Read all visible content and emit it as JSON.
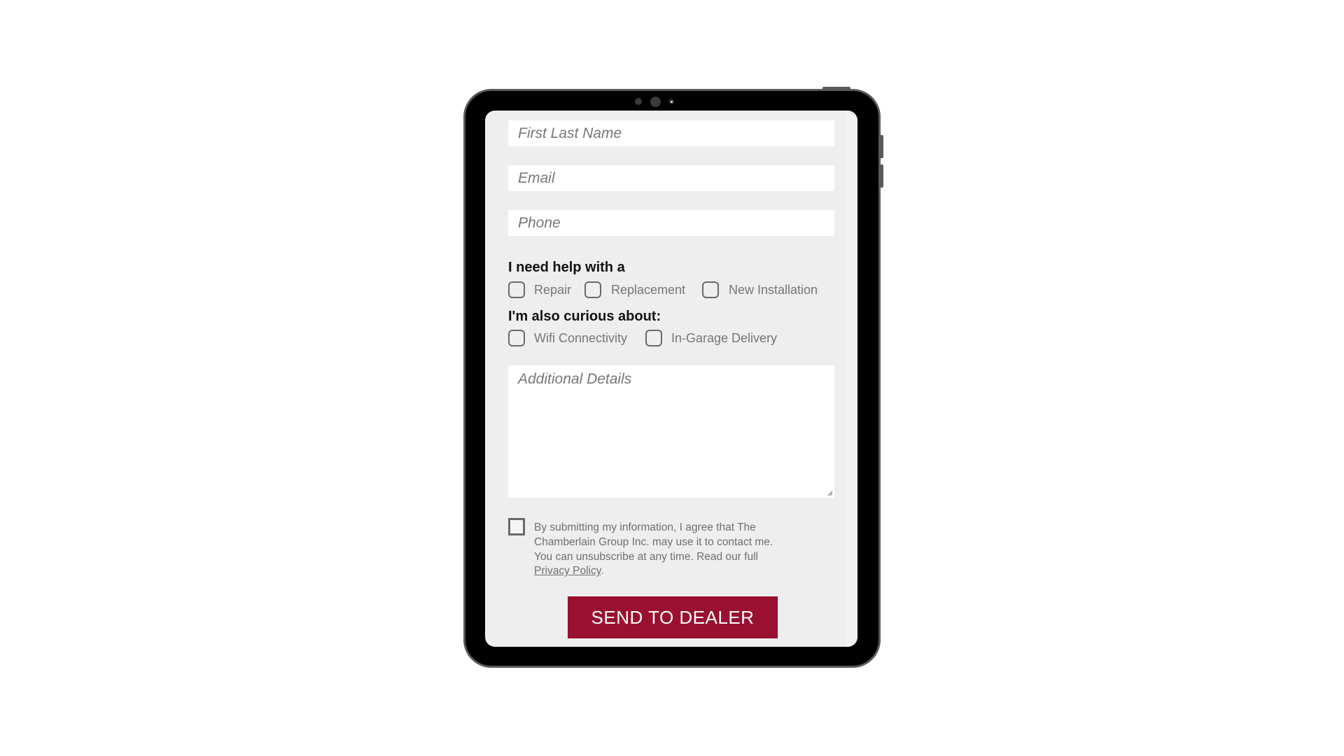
{
  "form": {
    "name_placeholder": "First Last Name",
    "email_placeholder": "Email",
    "phone_placeholder": "Phone",
    "help_heading": "I need help with a",
    "help_options": [
      {
        "label": "Repair",
        "checked": false
      },
      {
        "label": "Replacement",
        "checked": false
      },
      {
        "label": "New Installation",
        "checked": false
      }
    ],
    "curious_heading": "I'm also curious about:",
    "curious_options": [
      {
        "label": "Wifi Connectivity",
        "checked": false
      },
      {
        "label": "In-Garage Delivery",
        "checked": false
      }
    ],
    "details_placeholder": "Additional Details",
    "consent": {
      "checked": false,
      "text": "By submitting my information, I agree that The Chamberlain Group Inc. may use it to contact me. You can unsubscribe at any time. Read our full ",
      "link_text": "Privacy Policy",
      "suffix": "."
    },
    "submit_label": "SEND TO DEALER"
  },
  "colors": {
    "accent": "#9a1030",
    "screen_bg": "#eeeeee",
    "frame": "#000000"
  }
}
